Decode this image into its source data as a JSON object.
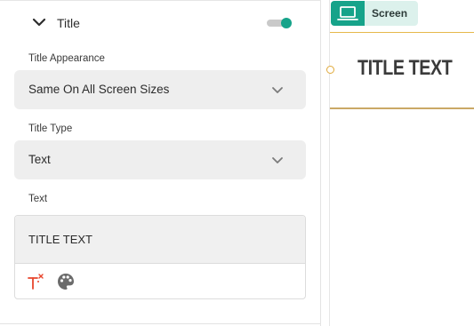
{
  "section": {
    "title": "Title",
    "enabled": true,
    "icons": {
      "collapse": "chevron-down-icon"
    }
  },
  "fields": {
    "appearance": {
      "label": "Title Appearance",
      "value": "Same On All Screen Sizes"
    },
    "type": {
      "label": "Title Type",
      "value": "Text"
    },
    "text": {
      "label": "Text",
      "value": "TITLE TEXT",
      "tools": [
        "ai-text-icon",
        "palette-icon"
      ]
    }
  },
  "preview": {
    "device_tab": {
      "label": "Screen",
      "icon": "laptop-icon"
    },
    "title_text": "TITLE TEXT"
  },
  "colors": {
    "accent": "#16a38a",
    "accent_light": "#dcf1ec",
    "selection": "#e6b84b",
    "ai_icon": "#e8452c"
  }
}
